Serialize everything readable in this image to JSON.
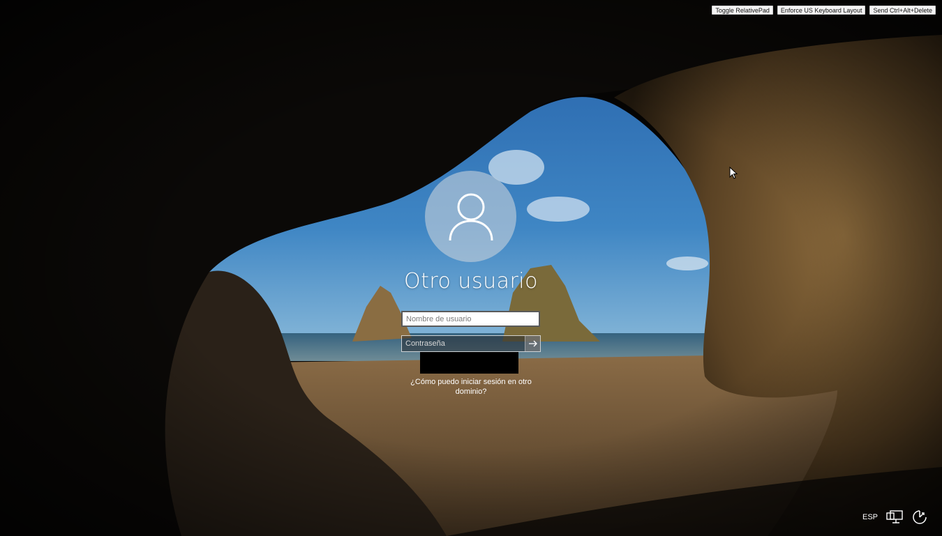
{
  "remote_toolbar": {
    "toggle_relative_pad": "Toggle RelativePad",
    "enforce_keyboard": "Enforce US Keyboard Layout",
    "send_cad": "Send Ctrl+Alt+Delete"
  },
  "login": {
    "user_name": "Otro usuario",
    "username_placeholder": "Nombre de usuario",
    "password_placeholder": "Contraseña",
    "domain_link": "¿Cómo puedo iniciar sesión en otro dominio?"
  },
  "tray": {
    "language": "ESP",
    "icons": [
      "network-icon",
      "accessibility-icon"
    ]
  },
  "colors": {
    "avatar_bg": "#c4ceda",
    "background": "#000000"
  }
}
